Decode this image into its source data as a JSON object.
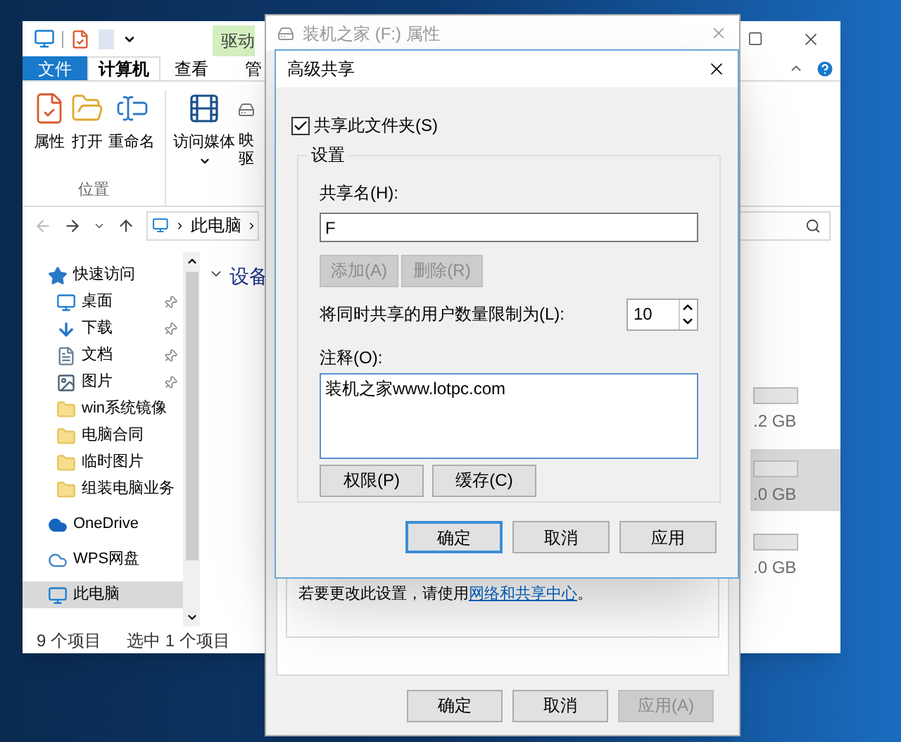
{
  "explorer": {
    "context_tab": "驱动",
    "ribbon_tabs": [
      {
        "label": "文件",
        "kind": "file",
        "selected": false
      },
      {
        "label": "计算机",
        "kind": "tab",
        "selected": true
      },
      {
        "label": "查看",
        "kind": "tab",
        "selected": false
      },
      {
        "label": "管",
        "kind": "tab",
        "selected": false
      }
    ],
    "ribbon_groups": [
      {
        "label": "位置",
        "items": [
          {
            "label": "属性",
            "kind": "properties"
          },
          {
            "label": "打开",
            "kind": "open"
          },
          {
            "label": "重命名",
            "kind": "rename"
          }
        ]
      },
      {
        "items": [
          {
            "label": "访问媒体",
            "kind": "media"
          },
          {
            "label": "映驱",
            "kind": "map"
          }
        ]
      }
    ],
    "address_path": [
      "此电脑"
    ],
    "nav_items": [
      {
        "label": "快速访问",
        "kind": "star",
        "selected": false,
        "children": [
          {
            "label": "桌面",
            "kind": "desktop",
            "pinned": true,
            "selected": false
          },
          {
            "label": "下载",
            "kind": "download",
            "pinned": true,
            "selected": false
          },
          {
            "label": "文档",
            "kind": "document",
            "pinned": true,
            "selected": false
          },
          {
            "label": "图片",
            "kind": "picture",
            "pinned": true,
            "selected": false
          },
          {
            "label": "win系统镜像",
            "kind": "folder",
            "pinned": false,
            "selected": false
          },
          {
            "label": "电脑合同",
            "kind": "folder",
            "pinned": false,
            "selected": false
          },
          {
            "label": "临时图片",
            "kind": "folder",
            "pinned": false,
            "selected": false
          },
          {
            "label": "组装电脑业务",
            "kind": "folder",
            "pinned": false,
            "selected": false
          }
        ]
      },
      {
        "label": "OneDrive",
        "kind": "onedrive",
        "selected": false
      },
      {
        "label": "WPS网盘",
        "kind": "cloud",
        "selected": false
      },
      {
        "label": "此电脑",
        "kind": "pc",
        "selected": true
      }
    ],
    "section_heading": "设备",
    "drives": [
      {
        "size": ".2 GB",
        "selected": false
      },
      {
        "size": ".0 GB",
        "selected": true
      },
      {
        "size": ".0 GB",
        "selected": false
      }
    ],
    "status_bar": {
      "item_count": "9 个项目",
      "selection": "选中 1 个项目"
    }
  },
  "properties_dialog": {
    "title": "装机之家 (F:) 属性",
    "note": "若要更改此设置，请使用",
    "note_link": "网络和共享中心",
    "note_end": "。",
    "buttons": [
      {
        "label": "确定",
        "disabled": false
      },
      {
        "label": "取消",
        "disabled": false
      },
      {
        "label": "应用(A)",
        "disabled": true
      }
    ]
  },
  "advanced_sharing": {
    "title": "高级共享",
    "share_checkbox": {
      "label": "共享此文件夹(S)",
      "checked": true
    },
    "group_label": "设置",
    "share_name_label": "共享名(H):",
    "share_name": "F",
    "share_name_buttons": [
      {
        "label": "添加(A)",
        "disabled": true
      },
      {
        "label": "删除(R)",
        "disabled": true
      }
    ],
    "user_limit_label": "将同时共享的用户数量限制为(L):",
    "user_limit": "10",
    "comment_label": "注释(O):",
    "comment": "装机之家www.lotpc.com",
    "option_buttons": [
      {
        "label": "权限(P)",
        "disabled": false
      },
      {
        "label": "缓存(C)",
        "disabled": false
      }
    ],
    "buttons": [
      {
        "label": "确定",
        "default": true
      },
      {
        "label": "取消",
        "default": false
      },
      {
        "label": "应用",
        "default": false
      }
    ]
  }
}
